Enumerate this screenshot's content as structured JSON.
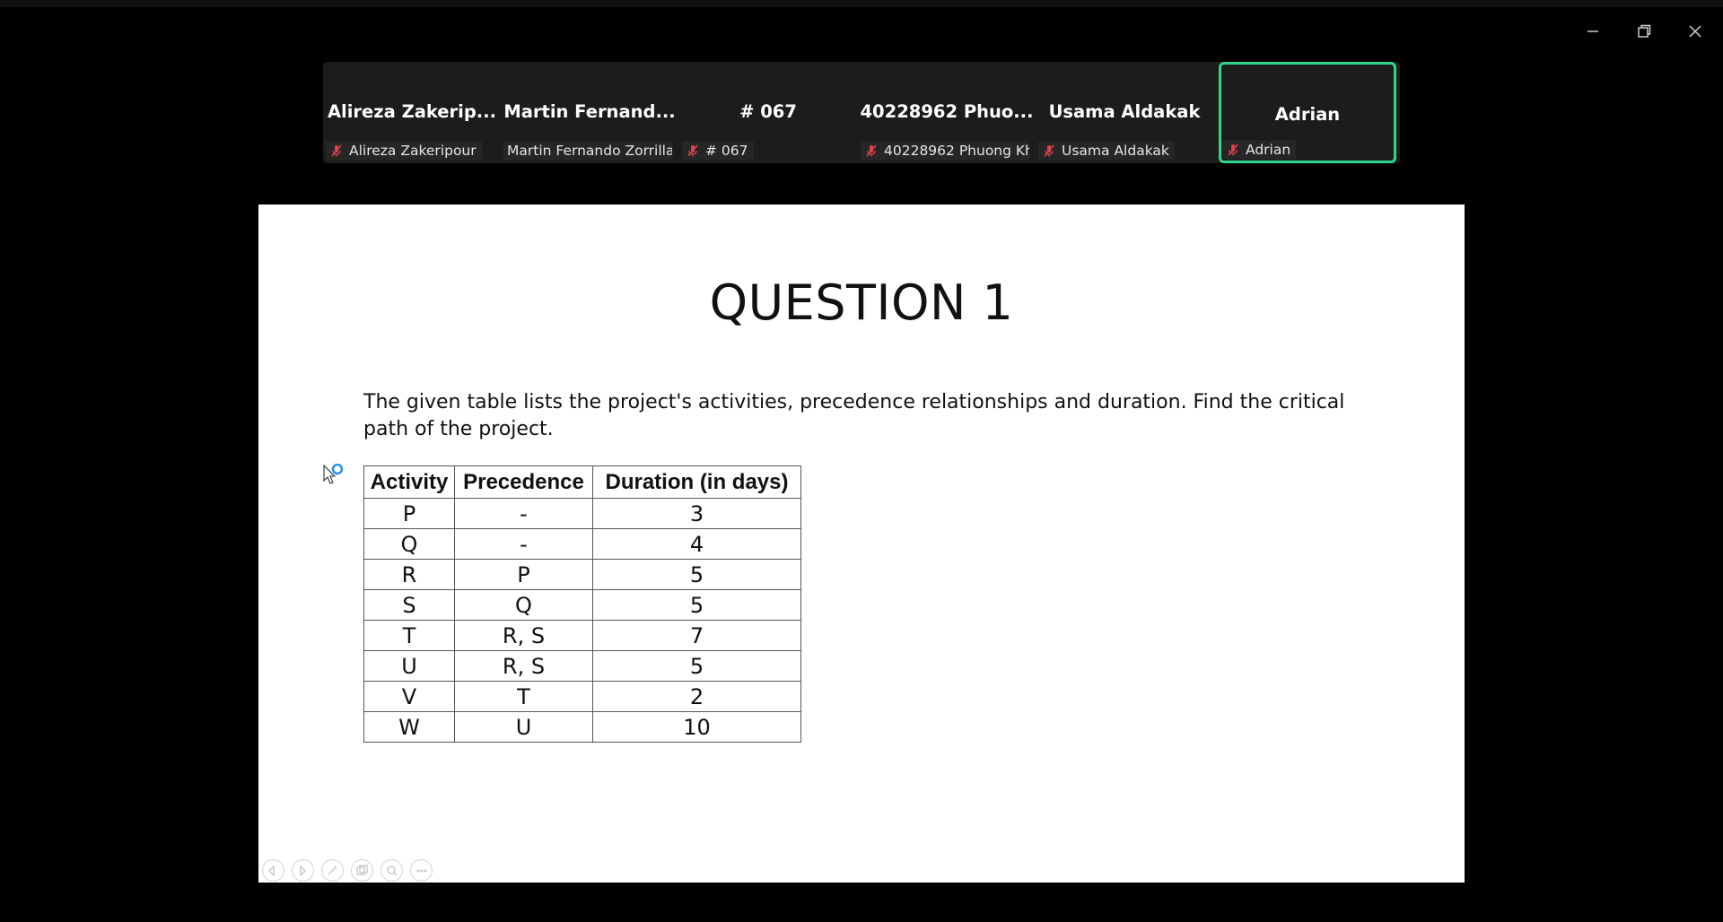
{
  "window": {
    "controls": [
      "minimize-icon",
      "restore-icon",
      "close-icon"
    ]
  },
  "participants": [
    {
      "display_name": "Alireza  Zakerip...",
      "label": "Alireza Zakeripour",
      "muted": true,
      "active": false
    },
    {
      "display_name": "Martin  Fernand...",
      "label": "Martin Fernando Zorrilla ...",
      "muted": false,
      "active": false
    },
    {
      "display_name": "# 067",
      "label": "# 067",
      "muted": true,
      "active": false
    },
    {
      "display_name": "40228962  Phuo...",
      "label": "40228962 Phuong Kh...",
      "muted": true,
      "active": false
    },
    {
      "display_name": "Usama Aldakak",
      "label": "Usama Aldakak",
      "muted": true,
      "active": false
    },
    {
      "display_name": "Adrian",
      "label": "Adrian",
      "muted": true,
      "active": true
    }
  ],
  "colors": {
    "active_speaker_border": "#2fd68a",
    "muted_icon": "#e0404f"
  },
  "slide": {
    "title": "QUESTION 1",
    "description": "The given table lists the project's activities, precedence relationships and duration. Find the critical path of the project.",
    "table": {
      "headers": [
        "Activity",
        "Precedence",
        "Duration (in days)"
      ],
      "rows": [
        [
          "P",
          "-",
          "3"
        ],
        [
          "Q",
          "-",
          "4"
        ],
        [
          "R",
          "P",
          "5"
        ],
        [
          "S",
          "Q",
          "5"
        ],
        [
          "T",
          "R, S",
          "7"
        ],
        [
          "U",
          "R, S",
          "5"
        ],
        [
          "V",
          "T",
          "2"
        ],
        [
          "W",
          "U",
          "10"
        ]
      ]
    }
  },
  "slide_controls": [
    "previous-icon",
    "next-icon",
    "pen-icon",
    "slides-icon",
    "zoom-icon",
    "more-icon"
  ]
}
